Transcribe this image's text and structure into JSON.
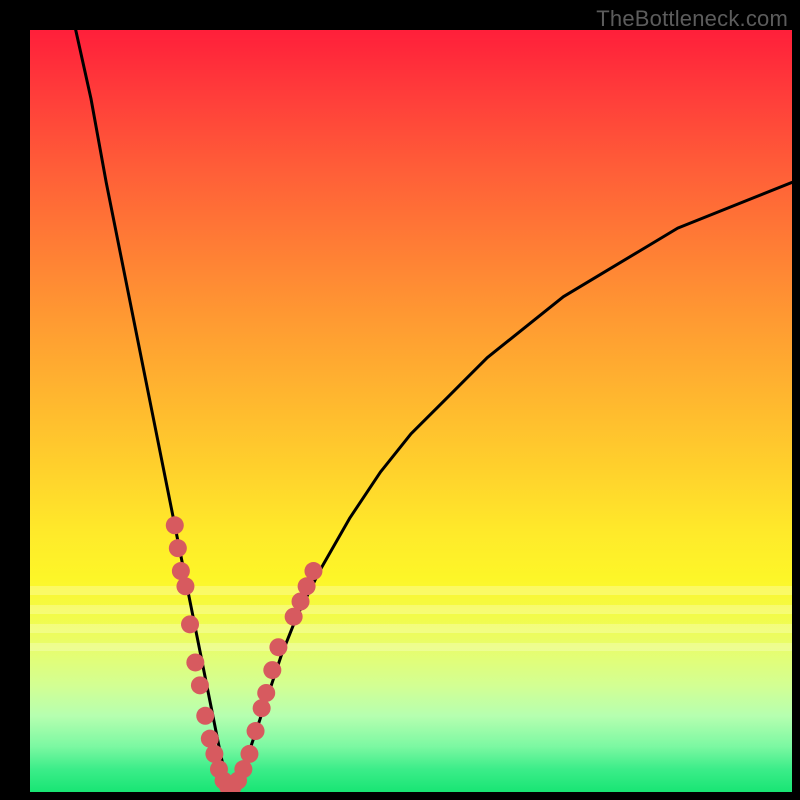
{
  "watermark": "TheBottleneck.com",
  "colors": {
    "line": "#000000",
    "dot_fill": "#d75a5f",
    "dot_stroke": "#b54348"
  },
  "chart_data": {
    "type": "line",
    "title": "",
    "xlabel": "",
    "ylabel": "",
    "xlim": [
      0,
      100
    ],
    "ylim": [
      0,
      100
    ],
    "note": "V-shaped bottleneck curve. y is percent bottleneck (lower is better). Minimum ≈0 near x≈26. Left branch starts near x≈6 at y≈100; right branch reaches y≈80 at x≈100.",
    "curve": {
      "x": [
        6,
        8,
        10,
        12,
        14,
        16,
        18,
        19,
        20,
        21,
        22,
        23,
        24,
        25,
        26,
        27,
        28,
        29,
        30,
        31,
        32,
        33,
        35,
        38,
        42,
        46,
        50,
        55,
        60,
        65,
        70,
        75,
        80,
        85,
        90,
        95,
        100
      ],
      "y": [
        100,
        91,
        80,
        70,
        60,
        50,
        40,
        35,
        30,
        25,
        20,
        15,
        10,
        5,
        0.5,
        0.5,
        3,
        6,
        9,
        12,
        15,
        18,
        23,
        29,
        36,
        42,
        47,
        52,
        57,
        61,
        65,
        68,
        71,
        74,
        76,
        78,
        80
      ]
    },
    "scatter": {
      "note": "Salmon dots clustered along the curve near the bottom of the V.",
      "points": [
        {
          "x": 19.0,
          "y": 35
        },
        {
          "x": 19.4,
          "y": 32
        },
        {
          "x": 19.8,
          "y": 29
        },
        {
          "x": 20.4,
          "y": 27
        },
        {
          "x": 21.0,
          "y": 22
        },
        {
          "x": 21.7,
          "y": 17
        },
        {
          "x": 22.3,
          "y": 14
        },
        {
          "x": 23.0,
          "y": 10
        },
        {
          "x": 23.6,
          "y": 7
        },
        {
          "x": 24.2,
          "y": 5
        },
        {
          "x": 24.8,
          "y": 3
        },
        {
          "x": 25.4,
          "y": 1.5
        },
        {
          "x": 26.0,
          "y": 0.7
        },
        {
          "x": 26.6,
          "y": 0.7
        },
        {
          "x": 27.3,
          "y": 1.5
        },
        {
          "x": 28.0,
          "y": 3
        },
        {
          "x": 28.8,
          "y": 5
        },
        {
          "x": 29.6,
          "y": 8
        },
        {
          "x": 30.4,
          "y": 11
        },
        {
          "x": 31.0,
          "y": 13
        },
        {
          "x": 31.8,
          "y": 16
        },
        {
          "x": 32.6,
          "y": 19
        },
        {
          "x": 34.6,
          "y": 23
        },
        {
          "x": 35.5,
          "y": 25
        },
        {
          "x": 36.3,
          "y": 27
        },
        {
          "x": 37.2,
          "y": 29
        }
      ]
    }
  }
}
